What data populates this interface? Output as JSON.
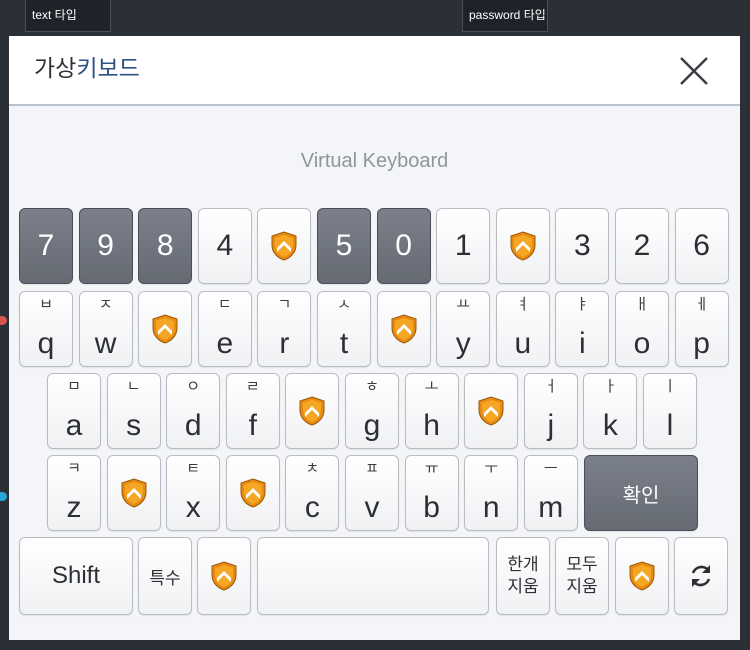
{
  "tabs": {
    "text_tab": "text 타입",
    "password_tab": "password 타입"
  },
  "dialog": {
    "title_part1": "가상",
    "title_part2": "키보드",
    "subtitle": "Virtual Keyboard"
  },
  "keys": {
    "row1": [
      "7",
      "9",
      "8",
      "4",
      "",
      "5",
      "0",
      "1",
      "",
      "3",
      "2",
      "6"
    ],
    "row2": [
      {
        "jamo": "ㅂ",
        "letter": "q"
      },
      {
        "jamo": "ㅈ",
        "letter": "w"
      },
      {
        "jamo": "",
        "letter": ""
      },
      {
        "jamo": "ㄷ",
        "letter": "e"
      },
      {
        "jamo": "ㄱ",
        "letter": "r"
      },
      {
        "jamo": "ㅅ",
        "letter": "t"
      },
      {
        "jamo": "",
        "letter": ""
      },
      {
        "jamo": "ㅛ",
        "letter": "y"
      },
      {
        "jamo": "ㅕ",
        "letter": "u"
      },
      {
        "jamo": "ㅑ",
        "letter": "i"
      },
      {
        "jamo": "ㅐ",
        "letter": "o"
      },
      {
        "jamo": "ㅔ",
        "letter": "p"
      }
    ],
    "row3": [
      {
        "jamo": "ㅁ",
        "letter": "a"
      },
      {
        "jamo": "ㄴ",
        "letter": "s"
      },
      {
        "jamo": "ㅇ",
        "letter": "d"
      },
      {
        "jamo": "ㄹ",
        "letter": "f"
      },
      {
        "jamo": "",
        "letter": ""
      },
      {
        "jamo": "ㅎ",
        "letter": "g"
      },
      {
        "jamo": "ㅗ",
        "letter": "h"
      },
      {
        "jamo": "",
        "letter": ""
      },
      {
        "jamo": "ㅓ",
        "letter": "j"
      },
      {
        "jamo": "ㅏ",
        "letter": "k"
      },
      {
        "jamo": "ㅣ",
        "letter": "l"
      }
    ],
    "row4": [
      {
        "jamo": "ㅋ",
        "letter": "z"
      },
      {
        "jamo": "",
        "letter": ""
      },
      {
        "jamo": "ㅌ",
        "letter": "x"
      },
      {
        "jamo": "",
        "letter": ""
      },
      {
        "jamo": "ㅊ",
        "letter": "c"
      },
      {
        "jamo": "ㅍ",
        "letter": "v"
      },
      {
        "jamo": "ㅠ",
        "letter": "b"
      },
      {
        "jamo": "ㅜ",
        "letter": "n"
      },
      {
        "jamo": "ㅡ",
        "letter": "m"
      }
    ],
    "confirm": "확인",
    "shift": "Shift",
    "special": "특수",
    "clear_one_line1": "한개",
    "clear_one_line2": "지움",
    "clear_all_line1": "모두",
    "clear_all_line2": "지움"
  },
  "icons": {
    "blank_key": "shield-logo-icon",
    "close": "close-icon",
    "refresh": "refresh-icon"
  },
  "colors": {
    "dark_key": "#6f747d",
    "title_accent": "#2f4f85",
    "shield_orange": "#e98a12"
  }
}
